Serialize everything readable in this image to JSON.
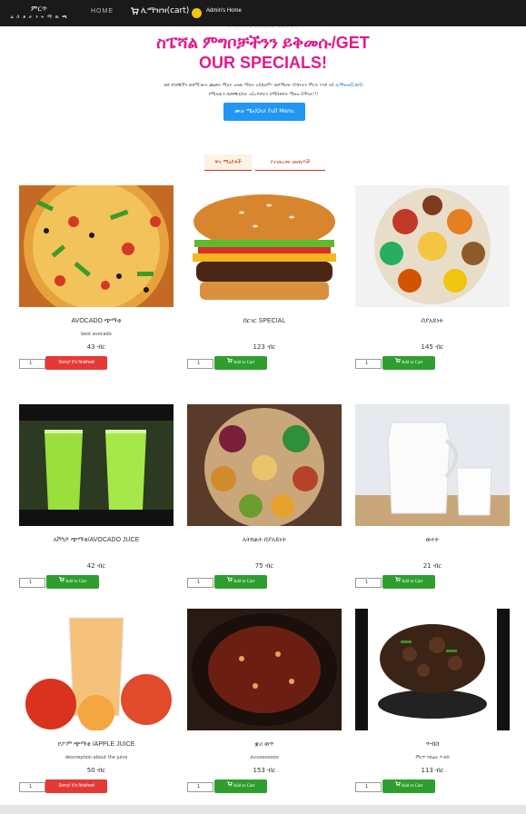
{
  "navbar": {
    "brand_line1": "ምርጥ",
    "brand_line2": "ሬ ስ ቶ ራ ን ት   ማ ዉ ጫ",
    "home_label": "HOME",
    "cart_label": "ሊማዝዝ(cart)",
    "admin_label": "Admin's Home"
  },
  "hero": {
    "faded_title": "restaurant",
    "title_line1": "ስፔሻል ምግቦቻችንን ይቅመሱ/GET",
    "title_line2": "OUR SPECIALS!",
    "desc_line1": "ወደ ደንበኞችን ወደሚገዙት ጨመሩ ማለት አዘዉ ማለት አይደለም። ወደማዘዣ ይግቡትን ምርት እንደ ላይ",
    "desc_link": "ሊማዝዝ(Cart)",
    "desc_line2": "የሚለውን በመጫን/ክት አይረሳዎትን በማስቀሰት ማዘዝ ይችላሉ!!!",
    "menu_button": "ሙሉ ሜኑ/Our Full Menu"
  },
  "tabs": [
    {
      "label": "ዋና ማዕደቶች"
    },
    {
      "label": "የተመረጡ መጠጦች"
    }
  ],
  "products": [
    {
      "name": "AVOCADO ጭማቂ",
      "desc": "best avocado",
      "price": "43 ብር",
      "qty": "1",
      "action": "Sorry! it's finished",
      "available": false
    },
    {
      "name": "በርገር SPECIAL",
      "desc": "",
      "price": "123 ብር",
      "qty": "1",
      "action": "Add to Cart",
      "available": true
    },
    {
      "name": "በያአይነት",
      "desc": "",
      "price": "145 ብር",
      "qty": "1",
      "action": "Add to Cart",
      "available": true
    },
    {
      "name": "አቮካዶ ጭማቂ/AVOCADO JUCE",
      "desc": "",
      "price": "42 ብር",
      "qty": "1",
      "action": "Add to Cart",
      "available": true
    },
    {
      "name": "አትክልት በያአይነት",
      "desc": "",
      "price": "75 ብር",
      "qty": "1",
      "action": "Add to Cart",
      "available": true
    },
    {
      "name": "ወተት",
      "desc": "",
      "price": "21 ብር",
      "qty": "1",
      "action": "Add to Cart",
      "available": true
    },
    {
      "name": "የፖም ጭማቂ /APPLE JUICE",
      "desc": "descreption about the juice",
      "price": "50 ብር",
      "qty": "1",
      "action": "Sorry! it's finished",
      "available": false
    },
    {
      "name": "ቋሪ ወጥ",
      "desc": "ታራoooooooo",
      "price": "153 ብር",
      "qty": "1",
      "action": "Add to Cart",
      "available": true
    },
    {
      "name": "ጥብስ",
      "desc": "ምርጥ የበሬት ጥብስ",
      "price": "113 ብር",
      "qty": "1",
      "action": "Add to Cart",
      "available": true
    }
  ],
  "colors": {
    "navbar": "#1a1a1a",
    "accent_pink": "#e21a8d",
    "primary_blue": "#2196f3",
    "add_green": "#2e9f2e",
    "sorry_red": "#e53935"
  }
}
